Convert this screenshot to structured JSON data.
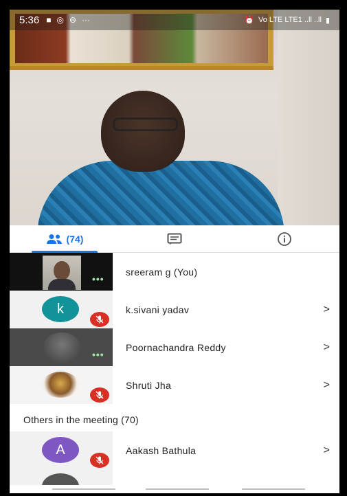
{
  "status_bar": {
    "time": "5:36",
    "indicators": "Vo LTE LTE1 ..ll ..ll"
  },
  "tabs": [
    {
      "label": "(74)",
      "icon": "people-icon",
      "active": true
    },
    {
      "label": "",
      "icon": "chat-icon",
      "active": false
    },
    {
      "label": "",
      "icon": "info-icon",
      "active": false
    }
  ],
  "participants": [
    {
      "name": "sreeram g (You)",
      "avatar": "photo",
      "muted": false,
      "speaking_dots": "•••"
    },
    {
      "name": "k.sivani yadav",
      "avatar_letter": "k",
      "avatar_color": "#12939a",
      "muted": true
    },
    {
      "name": "Poornachandra Reddy",
      "avatar": "photo",
      "muted": false,
      "speaking_dots": "•••"
    },
    {
      "name": "Shruti Jha",
      "avatar": "photo",
      "muted": true
    }
  ],
  "others_header": "Others in the meeting (70)",
  "others": [
    {
      "name": "Aakash Bathula",
      "avatar_letter": "A",
      "avatar_color": "#7e57c2",
      "muted": true
    }
  ],
  "chevron": ">",
  "colors": {
    "accent": "#1a73e8",
    "mute_red": "#d93025"
  }
}
